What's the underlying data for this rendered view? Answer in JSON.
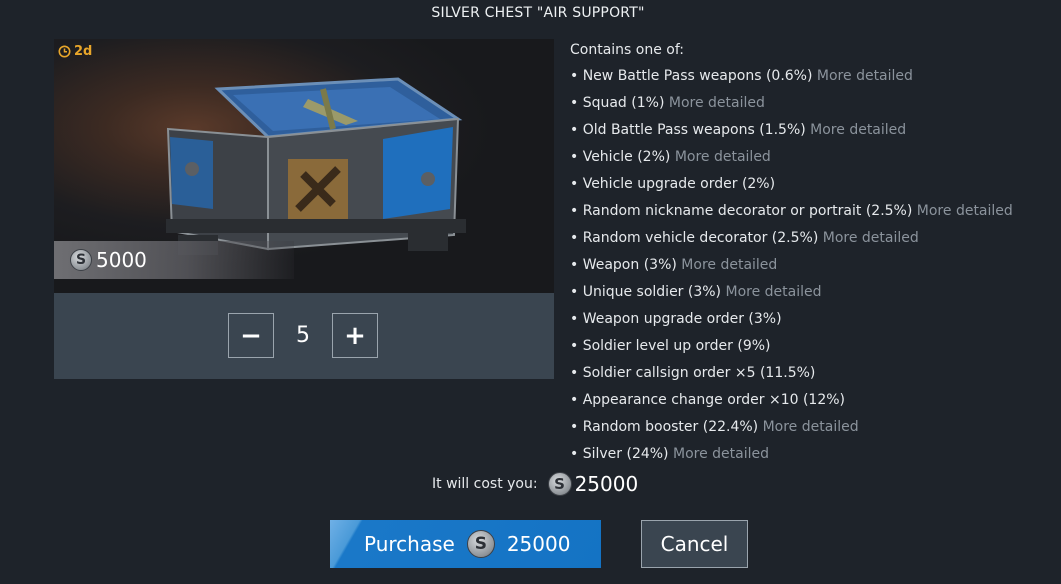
{
  "dialog": {
    "title": "SILVER CHEST \"AIR SUPPORT\""
  },
  "preview": {
    "timer": "2d",
    "price": "5000",
    "icons": {
      "timer": "clock-icon",
      "currency": "silver-coin-icon"
    }
  },
  "stepper": {
    "quantity": "5",
    "minus_label": "−",
    "plus_label": "+"
  },
  "contents": {
    "header": "Contains one of:",
    "items": [
      {
        "text": "• New Battle Pass weapons (0.6%)",
        "more": "More detailed"
      },
      {
        "text": "• Squad (1%)",
        "more": "More detailed"
      },
      {
        "text": "• Old Battle Pass weapons (1.5%)",
        "more": "More detailed"
      },
      {
        "text": "• Vehicle (2%)",
        "more": "More detailed"
      },
      {
        "text": "• Vehicle upgrade order (2%)",
        "more": ""
      },
      {
        "text": "• Random nickname decorator or portrait (2.5%)",
        "more": "More detailed"
      },
      {
        "text": "• Random vehicle decorator (2.5%)",
        "more": "More detailed"
      },
      {
        "text": "• Weapon (3%)",
        "more": "More detailed"
      },
      {
        "text": "• Unique soldier (3%)",
        "more": "More detailed"
      },
      {
        "text": "• Weapon upgrade order (3%)",
        "more": ""
      },
      {
        "text": "• Soldier level up order (9%)",
        "more": ""
      },
      {
        "text": "• Soldier callsign order ×5 (11.5%)",
        "more": ""
      },
      {
        "text": "• Appearance change order ×10 (12%)",
        "more": ""
      },
      {
        "text": "• Random booster (22.4%)",
        "more": "More detailed"
      },
      {
        "text": "• Silver (24%)",
        "more": "More detailed"
      }
    ]
  },
  "total": {
    "label": "It will cost you:",
    "amount": "25000"
  },
  "actions": {
    "purchase_label": "Purchase",
    "purchase_amount": "25000",
    "cancel_label": "Cancel"
  },
  "colors": {
    "background": "#1e232a",
    "accent_blue": "#1473c4",
    "timer": "#e8a62a",
    "muted_link": "#8b939c"
  }
}
